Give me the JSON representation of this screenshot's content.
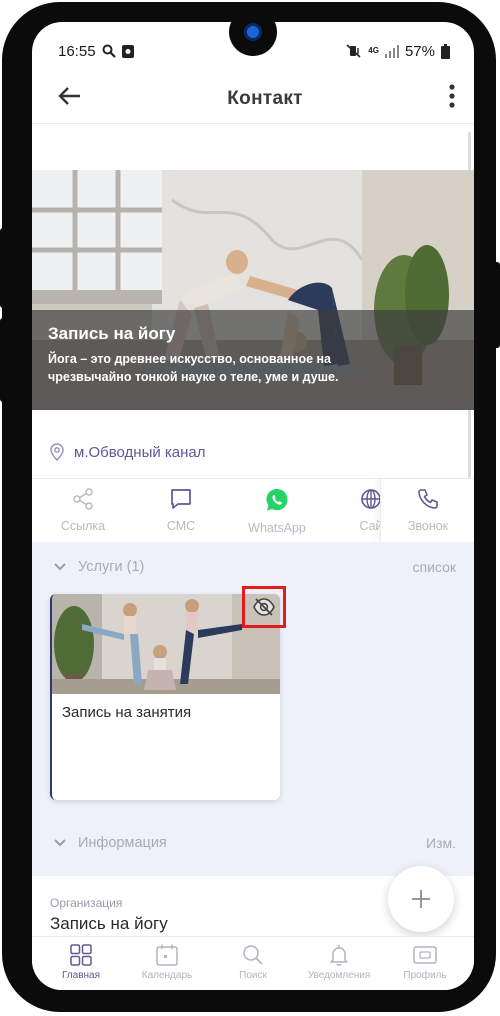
{
  "status_bar": {
    "time": "16:55",
    "network": "4G",
    "battery": "57%"
  },
  "appbar": {
    "title": "Контакт",
    "back_icon": "arrow-left-icon",
    "menu_icon": "more-vert-icon"
  },
  "hero": {
    "title": "Запись на йогу",
    "description_line1": "Йога – это древнее искусство, основанное на",
    "description_line2": "чрезвычайно тонкой науке о теле, уме и душе."
  },
  "location": {
    "text": "м.Обводный канал",
    "icon": "location-pin-icon"
  },
  "actions": [
    {
      "label": "Ссылка",
      "icon": "share-icon"
    },
    {
      "label": "СМС",
      "icon": "chat-icon"
    },
    {
      "label": "WhatsApp",
      "icon": "whatsapp-icon"
    },
    {
      "label": "Сай",
      "icon": "globe-icon"
    },
    {
      "label": "Звонок",
      "icon": "phone-icon"
    }
  ],
  "services": {
    "title": "Услуги (1)",
    "link": "список",
    "cards": [
      {
        "title": "Запись на занятия",
        "visibility_icon": "eye-off-icon"
      }
    ]
  },
  "info": {
    "title": "Информация",
    "link": "Изм.",
    "org_label": "Организация",
    "org_value": "Запись на йогу"
  },
  "bottom_nav": [
    {
      "label": "Главная",
      "icon": "grid-icon",
      "active": true
    },
    {
      "label": "Календарь",
      "icon": "calendar-icon",
      "active": false
    },
    {
      "label": "Поиск",
      "icon": "search-icon",
      "active": false
    },
    {
      "label": "Уведомления",
      "icon": "bell-icon",
      "active": false
    },
    {
      "label": "Профиль",
      "icon": "profile-card-icon",
      "active": false
    }
  ],
  "colors": {
    "accent": "#5b5a94",
    "highlight": "#e21b1b",
    "whatsapp": "#25d366",
    "section_bg": "#eef1f9"
  }
}
